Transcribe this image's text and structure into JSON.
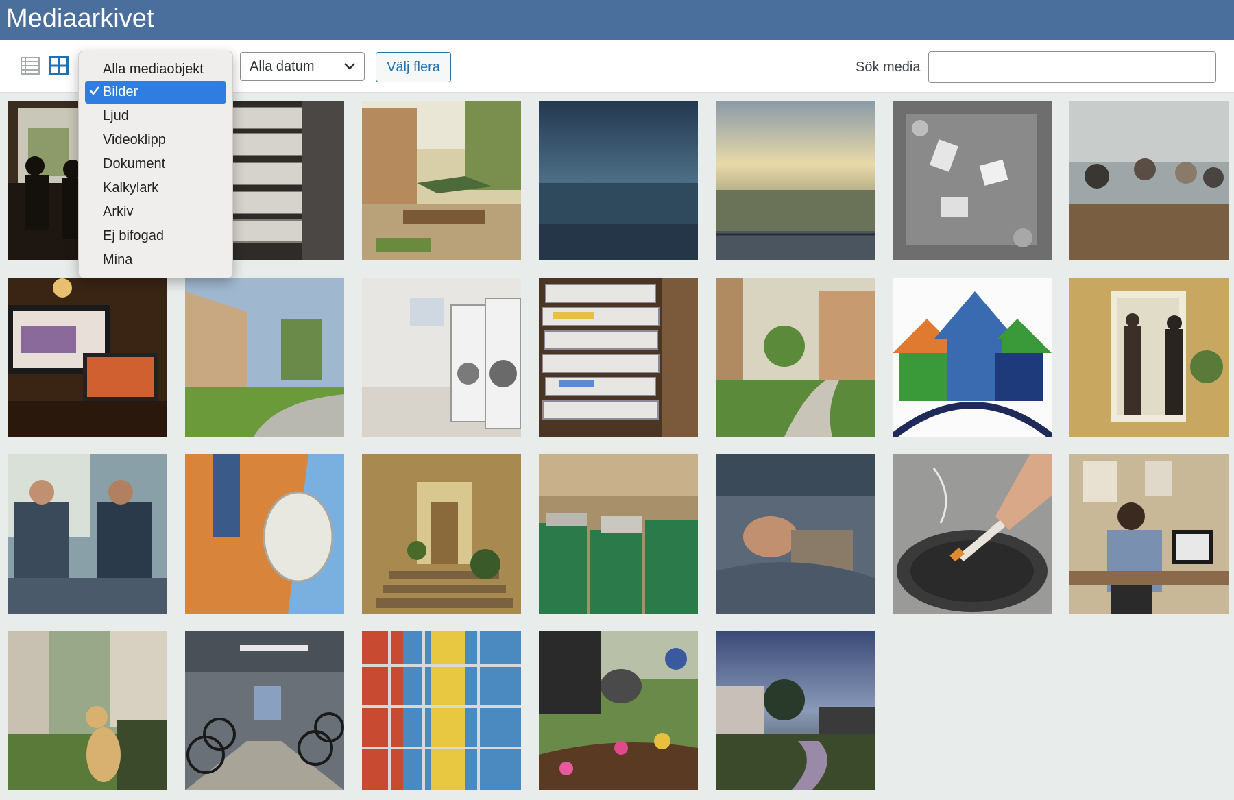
{
  "header": {
    "title": "Mediaarkivet"
  },
  "toolbar": {
    "list_view": "list-view-icon",
    "grid_view": "grid-view-icon",
    "date_filter": "Alla datum",
    "bulk_select": "Välj flera",
    "search_label": "Sök media",
    "search_value": ""
  },
  "type_filter": {
    "selected": "Bilder",
    "options": [
      "Alla mediaobjekt",
      "Bilder",
      "Ljud",
      "Videoklipp",
      "Dokument",
      "Kalkylark",
      "Arkiv",
      "Ej bifogad",
      "Mina"
    ]
  },
  "colors": {
    "header": "#4b6f9c",
    "accent": "#2271b1",
    "selected_option": "#2f7de1",
    "grid_background": "#e8ecea"
  },
  "media_grid": [
    {
      "subject": "people-at-window-photo"
    },
    {
      "subject": "binders-photo"
    },
    {
      "subject": "courtyard-cafe-photo"
    },
    {
      "subject": "blurred-blue-skyline-photo"
    },
    {
      "subject": "balcony-sunset-view-photo"
    },
    {
      "subject": "meeting-table-overhead-photo"
    },
    {
      "subject": "group-meeting-photo"
    },
    {
      "subject": "monitor-and-laptop-photo"
    },
    {
      "subject": "apartment-buildings-photo"
    },
    {
      "subject": "laundry-room-photo"
    },
    {
      "subject": "stacked-papers-photo"
    },
    {
      "subject": "residential-park-photo"
    },
    {
      "subject": "houses-logo-illustration"
    },
    {
      "subject": "people-in-hallway-photo"
    },
    {
      "subject": "plumbers-working-photo"
    },
    {
      "subject": "satellite-dish-photo"
    },
    {
      "subject": "stairwell-photo"
    },
    {
      "subject": "recycling-bins-photo"
    },
    {
      "subject": "man-sleeping-photo"
    },
    {
      "subject": "cigarette-ashtray-photo"
    },
    {
      "subject": "man-at-desk-photo"
    },
    {
      "subject": "dog-in-courtyard-photo"
    },
    {
      "subject": "bicycle-storage-photo"
    },
    {
      "subject": "scaffolding-facade-photo"
    },
    {
      "subject": "gardening-photo"
    },
    {
      "subject": "evening-path-photo"
    }
  ]
}
